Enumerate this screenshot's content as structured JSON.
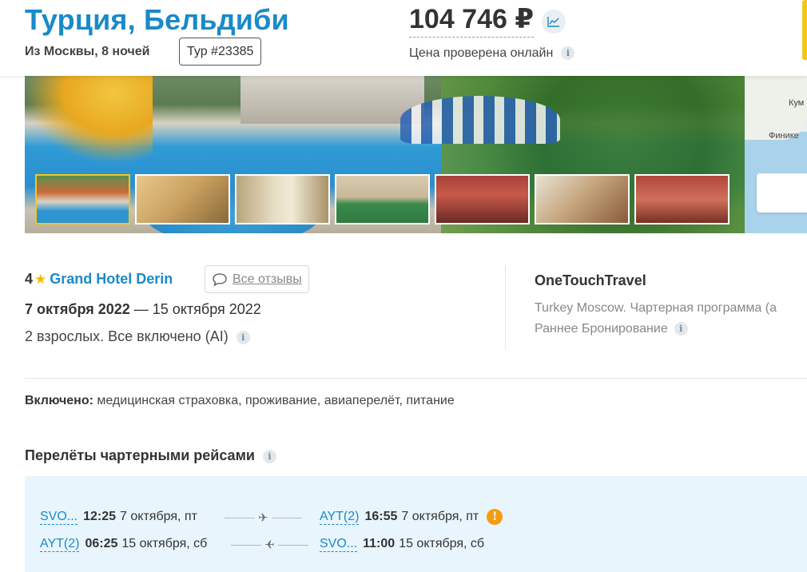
{
  "header": {
    "title": "Турция, Бельдиби",
    "subtitle": "Из Москвы, 8 ночей",
    "tour_badge": "Тур #23385",
    "price": "104 746 ₽",
    "price_checked": "Цена проверена онлайн",
    "price_chart_icon": "trend-chart-icon"
  },
  "map": {
    "label_top": "Кум",
    "label_city": "Финике"
  },
  "gallery": {
    "thumbnails": [
      {
        "label": "hotel-exterior"
      },
      {
        "label": "gym"
      },
      {
        "label": "room"
      },
      {
        "label": "billiards"
      },
      {
        "label": "restaurant"
      },
      {
        "label": "buffet"
      },
      {
        "label": "dining-hall"
      }
    ]
  },
  "hotel": {
    "stars": "4",
    "star_icon": "★",
    "name": "Grand Hotel Derin",
    "reviews_label": "Все отзывы",
    "date_from": "7 октября 2022",
    "date_sep": " — ",
    "date_to": "15 октября 2022",
    "guests": "2 взрослых. Все включено (AI)"
  },
  "operator": {
    "name": "OneTouchTravel",
    "program": "Turkey Moscow. Чартерная программа (а",
    "early": "Раннее Бронирование"
  },
  "included": {
    "label": "Включено:",
    "text": " медицинская страховка, проживание, авиаперелёт, питание"
  },
  "flights": {
    "title": "Перелёты чартерными рейсами",
    "outbound": {
      "from_code": "SVO...",
      "from_time": "12:25",
      "from_date": "7 октября, пт",
      "to_code": "AYT(2)",
      "to_time": "16:55",
      "to_date": "7 октября, пт",
      "warning": "!"
    },
    "return": {
      "from_code": "AYT(2)",
      "from_time": "06:25",
      "from_date": "15 октября, сб",
      "to_code": "SVO...",
      "to_time": "11:00",
      "to_date": "15 октября, сб"
    }
  },
  "colors": {
    "accent": "#1a8ac8",
    "star": "#f5b800",
    "warning": "#f39c12",
    "flights_bg": "#e8f5fd",
    "yellow_edge": "#f5c518"
  }
}
